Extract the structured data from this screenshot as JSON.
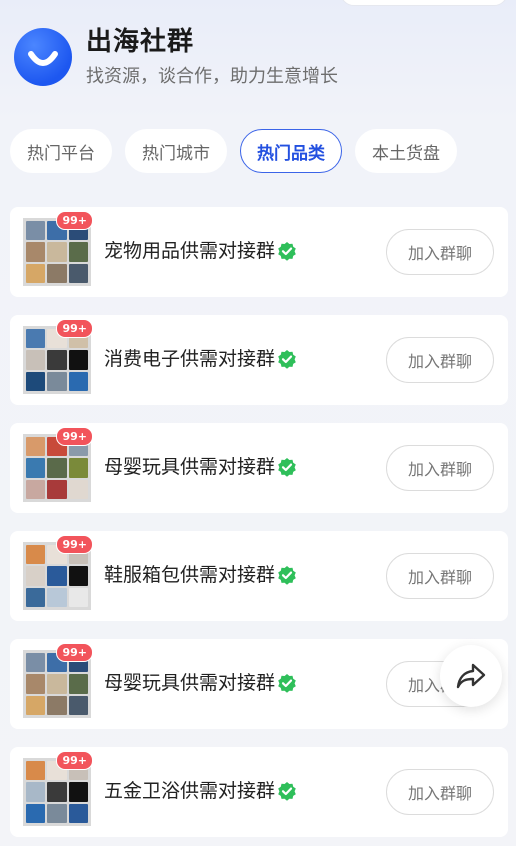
{
  "header": {
    "title": "出海社群",
    "subtitle": "找资源，谈合作，助力生意增长",
    "logo_icon": "chat-smile-logo-icon"
  },
  "tabs": [
    {
      "label": "热门平台",
      "active": false
    },
    {
      "label": "热门城市",
      "active": false
    },
    {
      "label": "热门品类",
      "active": true
    },
    {
      "label": "本土货盘",
      "active": false
    }
  ],
  "groups": [
    {
      "name": "宠物用品供需对接群",
      "badge": "99+",
      "join_label": "加入群聊",
      "colors": [
        "#7a8ea6",
        "#3d6ea8",
        "#2b4c78",
        "#a8886a",
        "#c9b89c",
        "#5a6c4a",
        "#d6a766",
        "#8c7a66",
        "#4a5a6c"
      ]
    },
    {
      "name": "消费电子供需对接群",
      "badge": "99+",
      "join_label": "加入群聊",
      "colors": [
        "#4a7ab0",
        "#e8e0d8",
        "#d0c0a8",
        "#c8c0b8",
        "#3a3a3a",
        "#111111",
        "#1d4a7a",
        "#7a8a9a",
        "#2a6ab0"
      ]
    },
    {
      "name": "母婴玩具供需对接群",
      "badge": "99+",
      "join_label": "加入群聊",
      "colors": [
        "#d89a6a",
        "#c84a3a",
        "#8a9aaa",
        "#3a7ab0",
        "#5a6a4a",
        "#7a8a3a",
        "#c8a8a0",
        "#a83a3a",
        "#e0d8d0"
      ]
    },
    {
      "name": "鞋服箱包供需对接群",
      "badge": "99+",
      "join_label": "加入群聊",
      "colors": [
        "#d88a4a",
        "#e8e0d8",
        "#c8c0b8",
        "#d8d0c8",
        "#2a5a9a",
        "#111111",
        "#3a6a9a",
        "#b8c8d8",
        "#e8e8e8"
      ]
    },
    {
      "name": "母婴玩具供需对接群",
      "badge": "99+",
      "join_label": "加入群聊",
      "colors": [
        "#7a8ea6",
        "#3d6ea8",
        "#2b4c78",
        "#a8886a",
        "#c9b89c",
        "#5a6c4a",
        "#d6a766",
        "#8c7a66",
        "#4a5a6c"
      ]
    },
    {
      "name": "五金卫浴供需对接群",
      "badge": "99+",
      "join_label": "加入群聊",
      "colors": [
        "#d88a4a",
        "#e8e0d8",
        "#c8c0b8",
        "#a8b8c8",
        "#3a3a3a",
        "#111111",
        "#2a6ab0",
        "#7a8a9a",
        "#2a5a9a"
      ]
    }
  ],
  "fab": {
    "icon": "share-icon"
  },
  "colors": {
    "accent": "#2350e0",
    "badge": "#f2545b",
    "verified": "#2fbf5a"
  }
}
